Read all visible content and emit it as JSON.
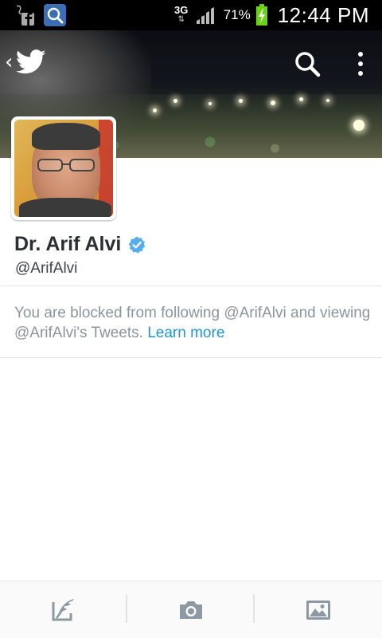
{
  "status_bar": {
    "network_type": "3G",
    "battery_percent": "71%",
    "time": "12:44 PM",
    "icons": [
      "facebook-notification-icon",
      "search-app-icon",
      "signal-icon",
      "battery-charging-icon"
    ],
    "battery_color": "#6bd11a"
  },
  "header": {
    "back_icon": "chevron-left-icon",
    "app_icon": "twitter-bird-icon",
    "actions": [
      "search-icon",
      "overflow-menu-icon"
    ]
  },
  "profile": {
    "name": "Dr. Arif Alvi",
    "verified": true,
    "handle": "@ArifAlvi",
    "verified_color": "#55acee"
  },
  "blocked_notice": {
    "text": "You are blocked from following @ArifAlvi and viewing @ArifAlvi's Tweets.",
    "link_label": "Learn more",
    "link_color": "#1c94e0"
  },
  "bottom_bar": {
    "actions": [
      "compose-tweet-icon",
      "camera-icon",
      "gallery-icon"
    ],
    "icon_color": "#8c99a4"
  }
}
